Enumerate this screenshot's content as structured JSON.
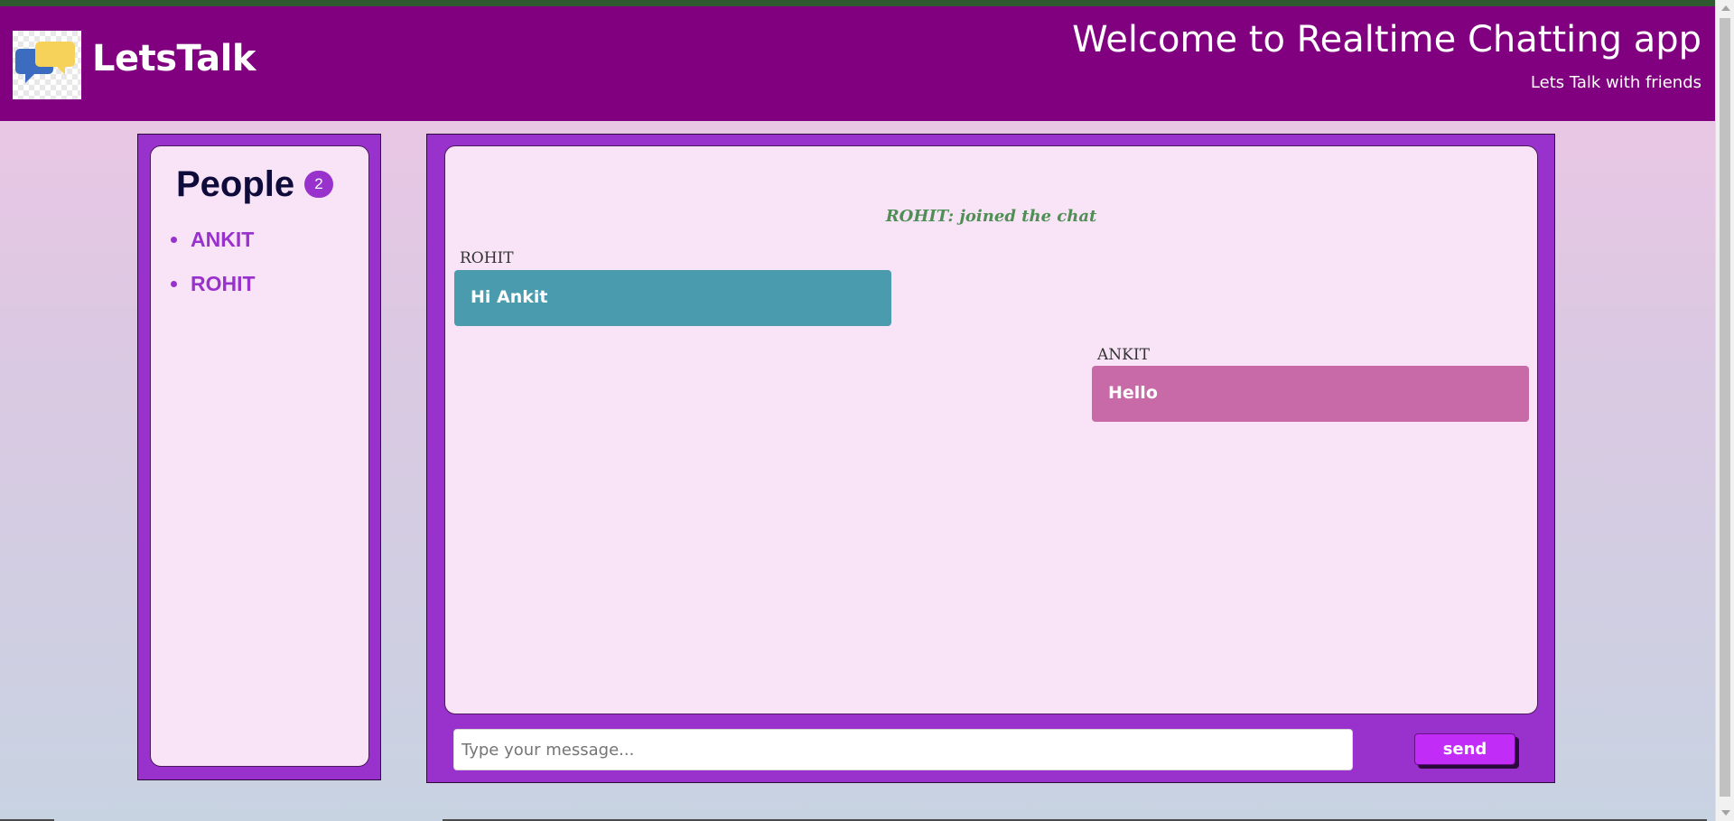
{
  "app": {
    "brand": "LetsTalk",
    "title": "Welcome to Realtime Chatting app",
    "subtitle": "Lets Talk with friends",
    "colors": {
      "header": "#800080",
      "panel": "#9932cc",
      "inner": "#f9e4f7",
      "accent": "#c12cf6"
    }
  },
  "people": {
    "title": "People",
    "count": "2",
    "list": [
      "ANKIT",
      "ROHIT"
    ]
  },
  "chat": {
    "notice": "ROHIT: joined the chat",
    "messages": [
      {
        "sender": "ROHIT",
        "text": "Hi Ankit",
        "side": "left"
      },
      {
        "sender": "ANKIT",
        "text": "Hello",
        "side": "right"
      }
    ],
    "input": {
      "value": "",
      "placeholder": "Type your message..."
    },
    "send_label": "send"
  },
  "icons": {
    "logo": "chat-bubbles-icon"
  }
}
